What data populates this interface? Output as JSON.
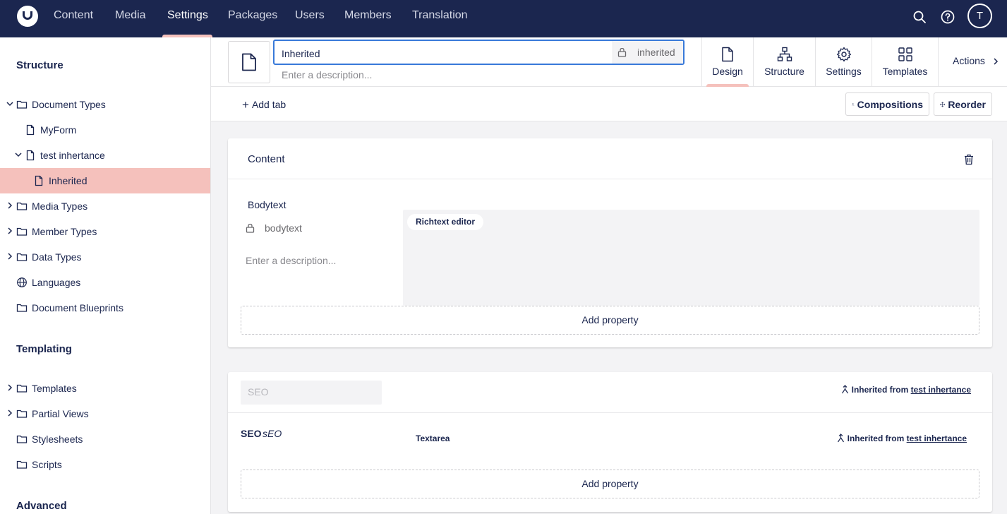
{
  "topbar": {
    "nav": [
      "Content",
      "Media",
      "Settings",
      "Packages",
      "Users",
      "Members",
      "Translation"
    ],
    "active_nav": "Settings",
    "avatar_initial": "T"
  },
  "sidebar": {
    "structure_heading": "Structure",
    "templating_heading": "Templating",
    "advanced_heading": "Advanced",
    "structure_items": [
      {
        "label": "Document Types",
        "expanded": true
      },
      {
        "label": "MyForm"
      },
      {
        "label": "test inhertance",
        "expanded": true
      },
      {
        "label": "Inherited",
        "selected": true
      },
      {
        "label": "Media Types"
      },
      {
        "label": "Member Types"
      },
      {
        "label": "Data Types"
      },
      {
        "label": "Languages"
      },
      {
        "label": "Document Blueprints"
      }
    ],
    "templating_items": [
      {
        "label": "Templates"
      },
      {
        "label": "Partial Views"
      },
      {
        "label": "Stylesheets"
      },
      {
        "label": "Scripts"
      }
    ]
  },
  "header": {
    "name_value": "Inherited",
    "alias_value": "inherited",
    "description_placeholder": "Enter a description...",
    "apps": [
      {
        "label": "Design",
        "active": true
      },
      {
        "label": "Structure"
      },
      {
        "label": "Settings"
      },
      {
        "label": "Templates"
      }
    ],
    "actions_label": "Actions"
  },
  "tabrow": {
    "add_tab_label": "Add tab",
    "compositions_label": "Compositions",
    "reorder_label": "Reorder"
  },
  "content_group": {
    "title": "Content",
    "property": {
      "name": "Bodytext",
      "alias": "bodytext",
      "description_placeholder": "Enter a description...",
      "editor": "Richtext editor"
    },
    "add_property_label": "Add property"
  },
  "seo_group": {
    "tab_name_placeholder": "SEO",
    "inherited_prefix": "Inherited from",
    "inherited_from": "test inhertance",
    "property": {
      "name": "SEO",
      "alias": "sEO",
      "editor": "Textarea",
      "inherited_prefix": "Inherited from",
      "inherited_from": "test inhertance"
    },
    "add_property_label": "Add property"
  },
  "colors": {
    "topbar": "#1b264f",
    "selected": "#f5c1bc",
    "focus_border": "#3879d9"
  }
}
